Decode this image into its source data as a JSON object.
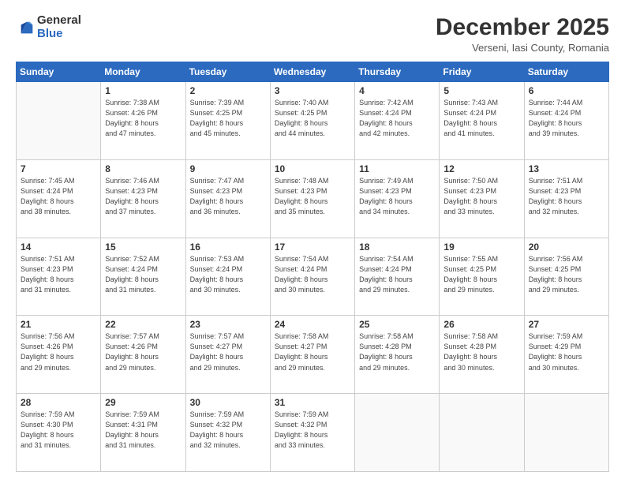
{
  "logo": {
    "general": "General",
    "blue": "Blue"
  },
  "header": {
    "month": "December 2025",
    "location": "Verseni, Iasi County, Romania"
  },
  "days_of_week": [
    "Sunday",
    "Monday",
    "Tuesday",
    "Wednesday",
    "Thursday",
    "Friday",
    "Saturday"
  ],
  "weeks": [
    [
      {
        "day": "",
        "info": ""
      },
      {
        "day": "1",
        "info": "Sunrise: 7:38 AM\nSunset: 4:26 PM\nDaylight: 8 hours\nand 47 minutes."
      },
      {
        "day": "2",
        "info": "Sunrise: 7:39 AM\nSunset: 4:25 PM\nDaylight: 8 hours\nand 45 minutes."
      },
      {
        "day": "3",
        "info": "Sunrise: 7:40 AM\nSunset: 4:25 PM\nDaylight: 8 hours\nand 44 minutes."
      },
      {
        "day": "4",
        "info": "Sunrise: 7:42 AM\nSunset: 4:24 PM\nDaylight: 8 hours\nand 42 minutes."
      },
      {
        "day": "5",
        "info": "Sunrise: 7:43 AM\nSunset: 4:24 PM\nDaylight: 8 hours\nand 41 minutes."
      },
      {
        "day": "6",
        "info": "Sunrise: 7:44 AM\nSunset: 4:24 PM\nDaylight: 8 hours\nand 39 minutes."
      }
    ],
    [
      {
        "day": "7",
        "info": "Sunrise: 7:45 AM\nSunset: 4:24 PM\nDaylight: 8 hours\nand 38 minutes."
      },
      {
        "day": "8",
        "info": "Sunrise: 7:46 AM\nSunset: 4:23 PM\nDaylight: 8 hours\nand 37 minutes."
      },
      {
        "day": "9",
        "info": "Sunrise: 7:47 AM\nSunset: 4:23 PM\nDaylight: 8 hours\nand 36 minutes."
      },
      {
        "day": "10",
        "info": "Sunrise: 7:48 AM\nSunset: 4:23 PM\nDaylight: 8 hours\nand 35 minutes."
      },
      {
        "day": "11",
        "info": "Sunrise: 7:49 AM\nSunset: 4:23 PM\nDaylight: 8 hours\nand 34 minutes."
      },
      {
        "day": "12",
        "info": "Sunrise: 7:50 AM\nSunset: 4:23 PM\nDaylight: 8 hours\nand 33 minutes."
      },
      {
        "day": "13",
        "info": "Sunrise: 7:51 AM\nSunset: 4:23 PM\nDaylight: 8 hours\nand 32 minutes."
      }
    ],
    [
      {
        "day": "14",
        "info": "Sunrise: 7:51 AM\nSunset: 4:23 PM\nDaylight: 8 hours\nand 31 minutes."
      },
      {
        "day": "15",
        "info": "Sunrise: 7:52 AM\nSunset: 4:24 PM\nDaylight: 8 hours\nand 31 minutes."
      },
      {
        "day": "16",
        "info": "Sunrise: 7:53 AM\nSunset: 4:24 PM\nDaylight: 8 hours\nand 30 minutes."
      },
      {
        "day": "17",
        "info": "Sunrise: 7:54 AM\nSunset: 4:24 PM\nDaylight: 8 hours\nand 30 minutes."
      },
      {
        "day": "18",
        "info": "Sunrise: 7:54 AM\nSunset: 4:24 PM\nDaylight: 8 hours\nand 29 minutes."
      },
      {
        "day": "19",
        "info": "Sunrise: 7:55 AM\nSunset: 4:25 PM\nDaylight: 8 hours\nand 29 minutes."
      },
      {
        "day": "20",
        "info": "Sunrise: 7:56 AM\nSunset: 4:25 PM\nDaylight: 8 hours\nand 29 minutes."
      }
    ],
    [
      {
        "day": "21",
        "info": "Sunrise: 7:56 AM\nSunset: 4:26 PM\nDaylight: 8 hours\nand 29 minutes."
      },
      {
        "day": "22",
        "info": "Sunrise: 7:57 AM\nSunset: 4:26 PM\nDaylight: 8 hours\nand 29 minutes."
      },
      {
        "day": "23",
        "info": "Sunrise: 7:57 AM\nSunset: 4:27 PM\nDaylight: 8 hours\nand 29 minutes."
      },
      {
        "day": "24",
        "info": "Sunrise: 7:58 AM\nSunset: 4:27 PM\nDaylight: 8 hours\nand 29 minutes."
      },
      {
        "day": "25",
        "info": "Sunrise: 7:58 AM\nSunset: 4:28 PM\nDaylight: 8 hours\nand 29 minutes."
      },
      {
        "day": "26",
        "info": "Sunrise: 7:58 AM\nSunset: 4:28 PM\nDaylight: 8 hours\nand 30 minutes."
      },
      {
        "day": "27",
        "info": "Sunrise: 7:59 AM\nSunset: 4:29 PM\nDaylight: 8 hours\nand 30 minutes."
      }
    ],
    [
      {
        "day": "28",
        "info": "Sunrise: 7:59 AM\nSunset: 4:30 PM\nDaylight: 8 hours\nand 31 minutes."
      },
      {
        "day": "29",
        "info": "Sunrise: 7:59 AM\nSunset: 4:31 PM\nDaylight: 8 hours\nand 31 minutes."
      },
      {
        "day": "30",
        "info": "Sunrise: 7:59 AM\nSunset: 4:32 PM\nDaylight: 8 hours\nand 32 minutes."
      },
      {
        "day": "31",
        "info": "Sunrise: 7:59 AM\nSunset: 4:32 PM\nDaylight: 8 hours\nand 33 minutes."
      },
      {
        "day": "",
        "info": ""
      },
      {
        "day": "",
        "info": ""
      },
      {
        "day": "",
        "info": ""
      }
    ]
  ]
}
